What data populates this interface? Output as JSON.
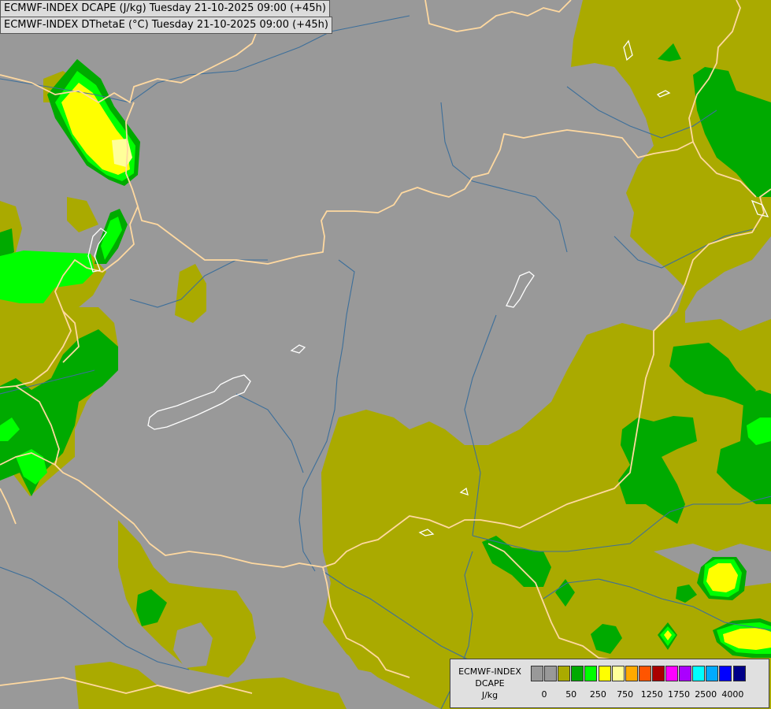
{
  "titles": {
    "line1": "ECMWF-INDEX DCAPE (J/kg) Tuesday 21-10-2025 09:00 (+45h)",
    "line2": "ECMWF-INDEX DThetaE (°C) Tuesday 21-10-2025 09:00 (+45h)"
  },
  "legend": {
    "model": "ECMWF-INDEX",
    "parameter": "DCAPE",
    "unit": "J/kg",
    "colors": [
      "#999999",
      "#999999",
      "#aaaa00",
      "#00aa00",
      "#00ff00",
      "#ffff00",
      "#ffff99",
      "#ffaa00",
      "#ff5500",
      "#aa0000",
      "#ff00ff",
      "#aa00ff",
      "#00ffff",
      "#00aaff",
      "#0000ff",
      "#000088"
    ],
    "tick_labels": [
      "0",
      "50",
      "250",
      "750",
      "1250",
      "1750",
      "2500",
      "4000"
    ]
  },
  "map_colors": {
    "background": "#999999",
    "olive": "#aaaa00",
    "green": "#00aa00",
    "lime": "#00ff00",
    "yellow": "#ffff00",
    "pale_yellow": "#ffff99",
    "border": "#ffd9a0",
    "river": "#3d6f9a",
    "lake": "#ffffff"
  }
}
